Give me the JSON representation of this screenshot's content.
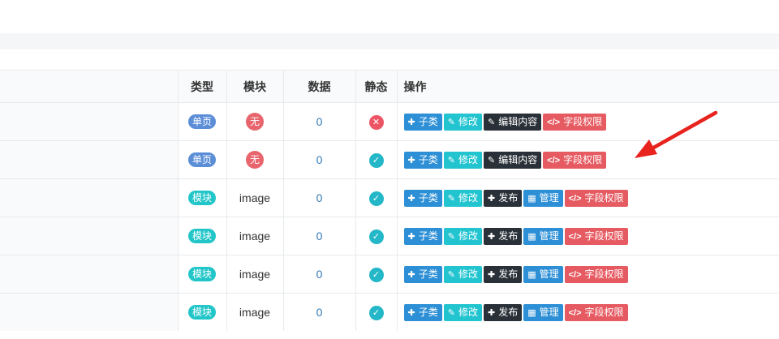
{
  "colors": {
    "page_badge": "#5c8ed8",
    "module_badge": "#23c6c8",
    "none_circle": "#e8656d",
    "status_ok": "#23b7c8",
    "status_no": "#ed5565",
    "btn_sub": "#2d8fd5",
    "btn_edit": "#22c4d0",
    "btn_dark": "#293038",
    "btn_manage": "#2d8fd5",
    "btn_field": "#e65b62",
    "arrow": "#e8231e"
  },
  "table": {
    "headers": {
      "type": "类型",
      "module": "模块",
      "data": "数据",
      "static": "静态",
      "ops": "操作"
    },
    "rows": [
      {
        "type": "单页",
        "type_kind": "page",
        "module": "无",
        "module_kind": "none",
        "data": "0",
        "status": "no",
        "ops": [
          {
            "icon": "✚",
            "label": "子类",
            "kind": "sub"
          },
          {
            "icon": "✎",
            "label": "修改",
            "kind": "edit"
          },
          {
            "icon": "✎",
            "label": "编辑内容",
            "kind": "dark"
          },
          {
            "icon": "</>",
            "label": "字段权限",
            "kind": "field"
          }
        ]
      },
      {
        "type": "单页",
        "type_kind": "page",
        "module": "无",
        "module_kind": "none",
        "data": "0",
        "status": "ok",
        "ops": [
          {
            "icon": "✚",
            "label": "子类",
            "kind": "sub"
          },
          {
            "icon": "✎",
            "label": "修改",
            "kind": "edit"
          },
          {
            "icon": "✎",
            "label": "编辑内容",
            "kind": "dark"
          },
          {
            "icon": "</>",
            "label": "字段权限",
            "kind": "field"
          }
        ]
      },
      {
        "type": "模块",
        "type_kind": "module",
        "module": "image",
        "module_kind": "text",
        "data": "0",
        "status": "ok",
        "ops": [
          {
            "icon": "✚",
            "label": "子类",
            "kind": "sub"
          },
          {
            "icon": "✎",
            "label": "修改",
            "kind": "edit"
          },
          {
            "icon": "✚",
            "label": "发布",
            "kind": "dark"
          },
          {
            "icon": "▦",
            "label": "管理",
            "kind": "manage"
          },
          {
            "icon": "</>",
            "label": "字段权限",
            "kind": "field"
          }
        ]
      },
      {
        "type": "模块",
        "type_kind": "module",
        "module": "image",
        "module_kind": "text",
        "data": "0",
        "status": "ok",
        "ops": [
          {
            "icon": "✚",
            "label": "子类",
            "kind": "sub"
          },
          {
            "icon": "✎",
            "label": "修改",
            "kind": "edit"
          },
          {
            "icon": "✚",
            "label": "发布",
            "kind": "dark"
          },
          {
            "icon": "▦",
            "label": "管理",
            "kind": "manage"
          },
          {
            "icon": "</>",
            "label": "字段权限",
            "kind": "field"
          }
        ]
      },
      {
        "type": "模块",
        "type_kind": "module",
        "module": "image",
        "module_kind": "text",
        "data": "0",
        "status": "ok",
        "ops": [
          {
            "icon": "✚",
            "label": "子类",
            "kind": "sub"
          },
          {
            "icon": "✎",
            "label": "修改",
            "kind": "edit"
          },
          {
            "icon": "✚",
            "label": "发布",
            "kind": "dark"
          },
          {
            "icon": "▦",
            "label": "管理",
            "kind": "manage"
          },
          {
            "icon": "</>",
            "label": "字段权限",
            "kind": "field"
          }
        ]
      },
      {
        "type": "模块",
        "type_kind": "module",
        "module": "image",
        "module_kind": "text",
        "data": "0",
        "status": "ok",
        "ops": [
          {
            "icon": "✚",
            "label": "子类",
            "kind": "sub"
          },
          {
            "icon": "✎",
            "label": "修改",
            "kind": "edit"
          },
          {
            "icon": "✚",
            "label": "发布",
            "kind": "dark"
          },
          {
            "icon": "▦",
            "label": "管理",
            "kind": "manage"
          },
          {
            "icon": "</>",
            "label": "字段权限",
            "kind": "field"
          }
        ]
      }
    ]
  }
}
